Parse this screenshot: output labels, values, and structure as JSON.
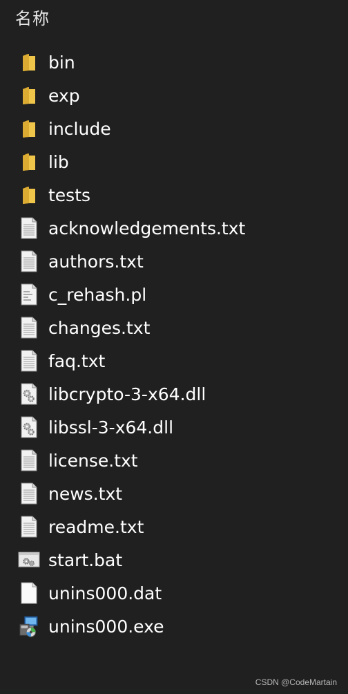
{
  "header": {
    "column_title": "名称",
    "top_glyph": "⌃"
  },
  "colors": {
    "background": "#202020",
    "text": "#ffffff",
    "folder": "#f0c64a",
    "document": "#f2f2f2"
  },
  "files": [
    {
      "name": "bin",
      "icon": "folder-icon",
      "kind": "folder"
    },
    {
      "name": "exp",
      "icon": "folder-icon",
      "kind": "folder"
    },
    {
      "name": "include",
      "icon": "folder-icon",
      "kind": "folder"
    },
    {
      "name": "lib",
      "icon": "folder-icon",
      "kind": "folder"
    },
    {
      "name": "tests",
      "icon": "folder-icon",
      "kind": "folder"
    },
    {
      "name": "acknowledgements.txt",
      "icon": "text-file-icon",
      "kind": "text"
    },
    {
      "name": "authors.txt",
      "icon": "text-file-icon",
      "kind": "text"
    },
    {
      "name": "c_rehash.pl",
      "icon": "script-file-icon",
      "kind": "script"
    },
    {
      "name": "changes.txt",
      "icon": "text-file-icon",
      "kind": "text"
    },
    {
      "name": "faq.txt",
      "icon": "text-file-icon",
      "kind": "text"
    },
    {
      "name": "libcrypto-3-x64.dll",
      "icon": "dll-file-icon",
      "kind": "dll"
    },
    {
      "name": "libssl-3-x64.dll",
      "icon": "dll-file-icon",
      "kind": "dll"
    },
    {
      "name": "license.txt",
      "icon": "text-file-icon",
      "kind": "text"
    },
    {
      "name": "news.txt",
      "icon": "text-file-icon",
      "kind": "text"
    },
    {
      "name": "readme.txt",
      "icon": "text-file-icon",
      "kind": "text"
    },
    {
      "name": "start.bat",
      "icon": "batch-file-icon",
      "kind": "batch"
    },
    {
      "name": "unins000.dat",
      "icon": "blank-file-icon",
      "kind": "blank"
    },
    {
      "name": "unins000.exe",
      "icon": "installer-icon",
      "kind": "installer"
    }
  ],
  "watermark": "CSDN @CodeMartain"
}
